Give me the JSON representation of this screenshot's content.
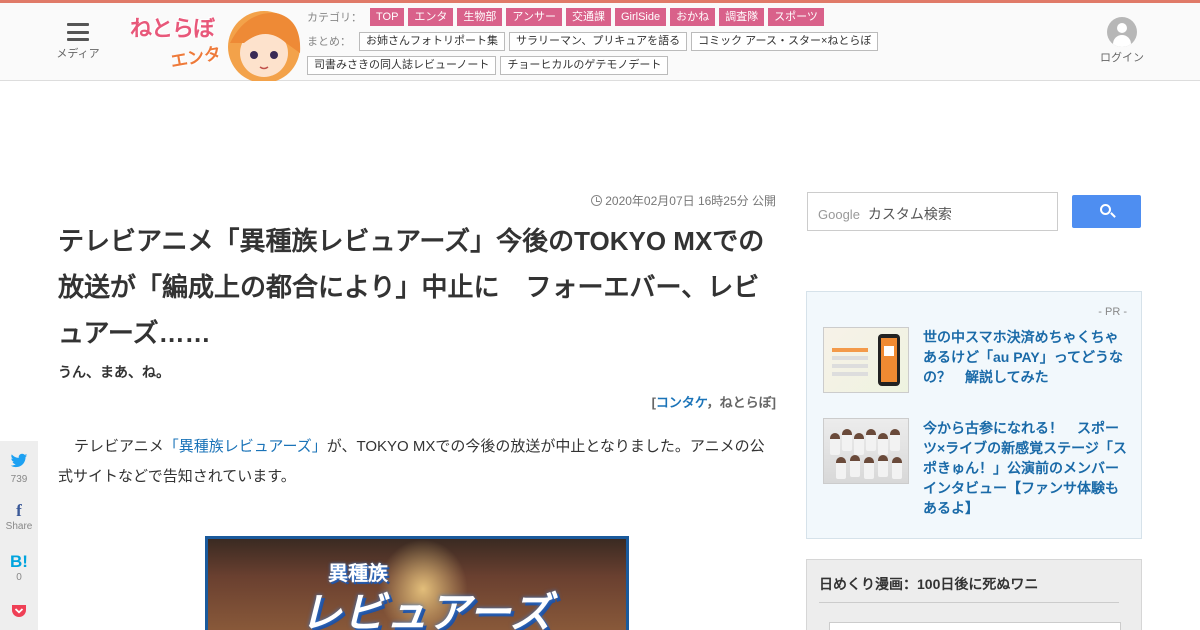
{
  "header": {
    "menu_label": "メディア",
    "logo_text": "ねとらぼ",
    "logo_sub": "エンタ",
    "category_label": "カテゴリ：",
    "categories": [
      "TOP",
      "エンタ",
      "生物部",
      "アンサー",
      "交通課",
      "GirlSide",
      "おかね",
      "調査隊",
      "スポーツ"
    ],
    "summary_label": "まとめ：",
    "summaries_row1": [
      "お姉さんフォトリポート集",
      "サラリーマン、プリキュアを語る",
      "コミック アース・スター×ねとらぼ"
    ],
    "summaries_row2": [
      "司書みさきの同人誌レビューノート",
      "チョーヒカルのゲテモノデート"
    ],
    "login_label": "ログイン"
  },
  "article": {
    "date": "2020年02月07日 16時25分 公開",
    "title": "テレビアニメ「異種族レビュアーズ」今後のTOKYO MXでの放送が「編成上の都合により」中止に　フォーエバー、レビュアーズ……",
    "subtitle": "うん、まあ、ね。",
    "credit_open": "[",
    "credit_author": "コンタケ",
    "credit_sep": "，",
    "credit_site": "ねとらぼ",
    "credit_close": "]",
    "body_before": "テレビアニメ",
    "body_link": "「異種族レビュアーズ」",
    "body_after": "が、TOKYO MXでの今後の放送が中止となりました。アニメの公式サイトなどで告知されています。",
    "image_small": "異種族",
    "image_big": "レビュアーズ"
  },
  "social": {
    "twitter_icon": "twitter-bird",
    "twitter_count": "739",
    "facebook_label": "Share",
    "hatena_icon": "B!",
    "hatena_count": "0"
  },
  "sidebar": {
    "search_brand": "Google",
    "search_placeholder": "カスタム検索",
    "pr_label": "- PR -",
    "pr_items": [
      {
        "text": "世の中スマホ決済めちゃくちゃあるけど「au PAY」ってどうなの？　解説してみた"
      },
      {
        "text": "今から古参になれる！　スポーツ×ライブの新感覚ステージ「スポきゅん！」公演前のメンバーインタビュー【ファンサ体験もあるよ】"
      }
    ],
    "manga_title": "日めくり漫画：100日後に死ぬワニ"
  },
  "colors": {
    "accent": "#e07a68",
    "category_tag": "#d9618a",
    "link": "#1a73b8",
    "search_button": "#4e8ef1"
  }
}
